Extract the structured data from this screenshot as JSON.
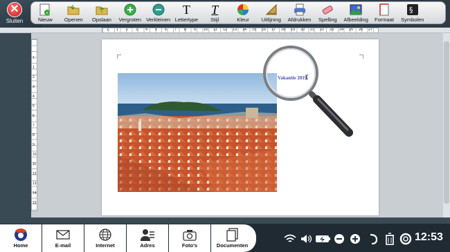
{
  "header": {
    "close_label": "Sluiten"
  },
  "toolbar": {
    "items": [
      {
        "label": "Nieuw",
        "icon": "new-document-icon"
      },
      {
        "label": "Openen",
        "icon": "open-folder-icon"
      },
      {
        "label": "Opslaan",
        "icon": "save-icon"
      },
      {
        "label": "Vergroten",
        "icon": "zoom-in-icon"
      },
      {
        "label": "Verkleinen",
        "icon": "zoom-out-icon"
      },
      {
        "label": "Lettertype",
        "icon": "font-icon"
      },
      {
        "label": "Stijl",
        "icon": "style-icon"
      },
      {
        "label": "Kleur",
        "icon": "color-icon"
      },
      {
        "label": "Uitlijning",
        "icon": "align-icon"
      },
      {
        "label": "Afdrukken",
        "icon": "print-icon"
      },
      {
        "label": "Spelling",
        "icon": "spelling-icon"
      },
      {
        "label": "Afbeelding",
        "icon": "image-icon"
      },
      {
        "label": "Formaat",
        "icon": "format-icon"
      },
      {
        "label": "Symbolen",
        "icon": "symbols-icon"
      }
    ]
  },
  "ruler": {
    "h_marks": [
      "1",
      "1",
      "2",
      "3",
      "4",
      "5",
      "6",
      "7",
      "8",
      "9",
      "10",
      "11",
      "12",
      "13",
      "14",
      "15",
      "16",
      "17",
      "18",
      "19",
      "20",
      "21",
      "22",
      "23",
      "24",
      "25",
      "26",
      "27"
    ],
    "v_marks": [
      "1",
      "1",
      "2",
      "3",
      "4",
      "5",
      "6",
      "7",
      "8",
      "9",
      "10",
      "11",
      "12",
      "13",
      "14",
      "15",
      "16"
    ]
  },
  "document": {
    "text": "Vakantie 2019",
    "image_alt": "photo-dubrovnik-old-town"
  },
  "dock": {
    "items": [
      {
        "label": "Home",
        "icon": "home-icon"
      },
      {
        "label": "E-mail",
        "icon": "email-icon"
      },
      {
        "label": "Internet",
        "icon": "globe-icon"
      },
      {
        "label": "Adres",
        "icon": "contacts-icon"
      },
      {
        "label": "Foto's",
        "icon": "camera-icon"
      },
      {
        "label": "Documenten",
        "icon": "documents-icon"
      }
    ]
  },
  "status": {
    "time": "12:53"
  },
  "colors": {
    "accent": "#2a2aa0",
    "toolbar_bg": "#e6e8ea",
    "dock_bg": "#ffffff",
    "bar_bg": "#1f2a33"
  }
}
